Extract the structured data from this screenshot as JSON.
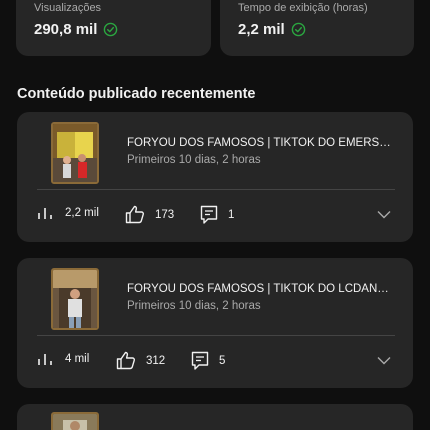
{
  "stats": [
    {
      "label": "Visualizações",
      "value": "290,8 mil"
    },
    {
      "label": "Tempo de exibição (horas)",
      "value": "2,2 mil"
    }
  ],
  "section_title": "Conteúdo publicado recentemente",
  "videos": [
    {
      "title": "FORYOU DOS FAMOSOS | TIKTOK DO EMERSON E ...",
      "subtitle": "Primeiros 10 dias, 2 horas",
      "views": "2,2 mil",
      "likes": "173",
      "comments": "1"
    },
    {
      "title": "FORYOU DOS FAMOSOS | TIKTOK DO LCDANCY!! #...",
      "subtitle": "Primeiros 10 dias, 2 horas",
      "views": "4 mil",
      "likes": "312",
      "comments": "5"
    }
  ],
  "colors": {
    "background": "#0f0f0f",
    "card": "#262626",
    "check": "#2ba640"
  },
  "icons": [
    "check-circle-icon",
    "bar-chart-icon",
    "thumb-up-icon",
    "comment-icon",
    "chevron-down-icon"
  ]
}
